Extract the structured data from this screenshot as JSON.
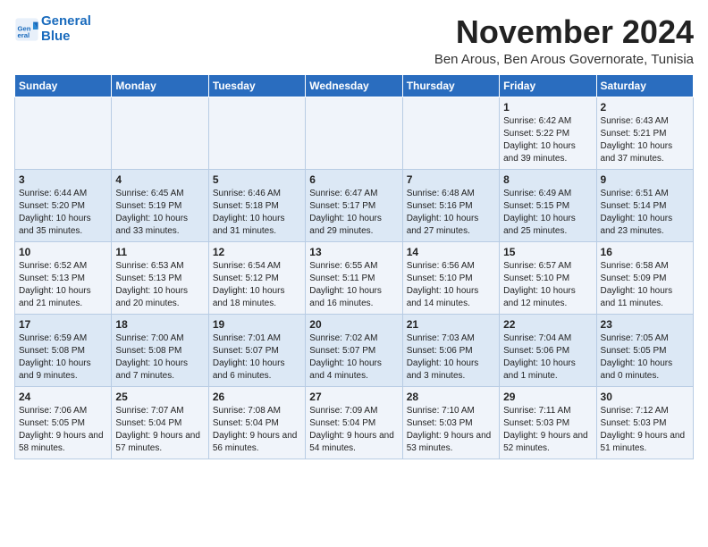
{
  "header": {
    "logo_line1": "General",
    "logo_line2": "Blue",
    "month_title": "November 2024",
    "location": "Ben Arous, Ben Arous Governorate, Tunisia"
  },
  "weekdays": [
    "Sunday",
    "Monday",
    "Tuesday",
    "Wednesday",
    "Thursday",
    "Friday",
    "Saturday"
  ],
  "weeks": [
    [
      {
        "day": "",
        "info": ""
      },
      {
        "day": "",
        "info": ""
      },
      {
        "day": "",
        "info": ""
      },
      {
        "day": "",
        "info": ""
      },
      {
        "day": "",
        "info": ""
      },
      {
        "day": "1",
        "info": "Sunrise: 6:42 AM\nSunset: 5:22 PM\nDaylight: 10 hours and 39 minutes."
      },
      {
        "day": "2",
        "info": "Sunrise: 6:43 AM\nSunset: 5:21 PM\nDaylight: 10 hours and 37 minutes."
      }
    ],
    [
      {
        "day": "3",
        "info": "Sunrise: 6:44 AM\nSunset: 5:20 PM\nDaylight: 10 hours and 35 minutes."
      },
      {
        "day": "4",
        "info": "Sunrise: 6:45 AM\nSunset: 5:19 PM\nDaylight: 10 hours and 33 minutes."
      },
      {
        "day": "5",
        "info": "Sunrise: 6:46 AM\nSunset: 5:18 PM\nDaylight: 10 hours and 31 minutes."
      },
      {
        "day": "6",
        "info": "Sunrise: 6:47 AM\nSunset: 5:17 PM\nDaylight: 10 hours and 29 minutes."
      },
      {
        "day": "7",
        "info": "Sunrise: 6:48 AM\nSunset: 5:16 PM\nDaylight: 10 hours and 27 minutes."
      },
      {
        "day": "8",
        "info": "Sunrise: 6:49 AM\nSunset: 5:15 PM\nDaylight: 10 hours and 25 minutes."
      },
      {
        "day": "9",
        "info": "Sunrise: 6:51 AM\nSunset: 5:14 PM\nDaylight: 10 hours and 23 minutes."
      }
    ],
    [
      {
        "day": "10",
        "info": "Sunrise: 6:52 AM\nSunset: 5:13 PM\nDaylight: 10 hours and 21 minutes."
      },
      {
        "day": "11",
        "info": "Sunrise: 6:53 AM\nSunset: 5:13 PM\nDaylight: 10 hours and 20 minutes."
      },
      {
        "day": "12",
        "info": "Sunrise: 6:54 AM\nSunset: 5:12 PM\nDaylight: 10 hours and 18 minutes."
      },
      {
        "day": "13",
        "info": "Sunrise: 6:55 AM\nSunset: 5:11 PM\nDaylight: 10 hours and 16 minutes."
      },
      {
        "day": "14",
        "info": "Sunrise: 6:56 AM\nSunset: 5:10 PM\nDaylight: 10 hours and 14 minutes."
      },
      {
        "day": "15",
        "info": "Sunrise: 6:57 AM\nSunset: 5:10 PM\nDaylight: 10 hours and 12 minutes."
      },
      {
        "day": "16",
        "info": "Sunrise: 6:58 AM\nSunset: 5:09 PM\nDaylight: 10 hours and 11 minutes."
      }
    ],
    [
      {
        "day": "17",
        "info": "Sunrise: 6:59 AM\nSunset: 5:08 PM\nDaylight: 10 hours and 9 minutes."
      },
      {
        "day": "18",
        "info": "Sunrise: 7:00 AM\nSunset: 5:08 PM\nDaylight: 10 hours and 7 minutes."
      },
      {
        "day": "19",
        "info": "Sunrise: 7:01 AM\nSunset: 5:07 PM\nDaylight: 10 hours and 6 minutes."
      },
      {
        "day": "20",
        "info": "Sunrise: 7:02 AM\nSunset: 5:07 PM\nDaylight: 10 hours and 4 minutes."
      },
      {
        "day": "21",
        "info": "Sunrise: 7:03 AM\nSunset: 5:06 PM\nDaylight: 10 hours and 3 minutes."
      },
      {
        "day": "22",
        "info": "Sunrise: 7:04 AM\nSunset: 5:06 PM\nDaylight: 10 hours and 1 minute."
      },
      {
        "day": "23",
        "info": "Sunrise: 7:05 AM\nSunset: 5:05 PM\nDaylight: 10 hours and 0 minutes."
      }
    ],
    [
      {
        "day": "24",
        "info": "Sunrise: 7:06 AM\nSunset: 5:05 PM\nDaylight: 9 hours and 58 minutes."
      },
      {
        "day": "25",
        "info": "Sunrise: 7:07 AM\nSunset: 5:04 PM\nDaylight: 9 hours and 57 minutes."
      },
      {
        "day": "26",
        "info": "Sunrise: 7:08 AM\nSunset: 5:04 PM\nDaylight: 9 hours and 56 minutes."
      },
      {
        "day": "27",
        "info": "Sunrise: 7:09 AM\nSunset: 5:04 PM\nDaylight: 9 hours and 54 minutes."
      },
      {
        "day": "28",
        "info": "Sunrise: 7:10 AM\nSunset: 5:03 PM\nDaylight: 9 hours and 53 minutes."
      },
      {
        "day": "29",
        "info": "Sunrise: 7:11 AM\nSunset: 5:03 PM\nDaylight: 9 hours and 52 minutes."
      },
      {
        "day": "30",
        "info": "Sunrise: 7:12 AM\nSunset: 5:03 PM\nDaylight: 9 hours and 51 minutes."
      }
    ]
  ]
}
